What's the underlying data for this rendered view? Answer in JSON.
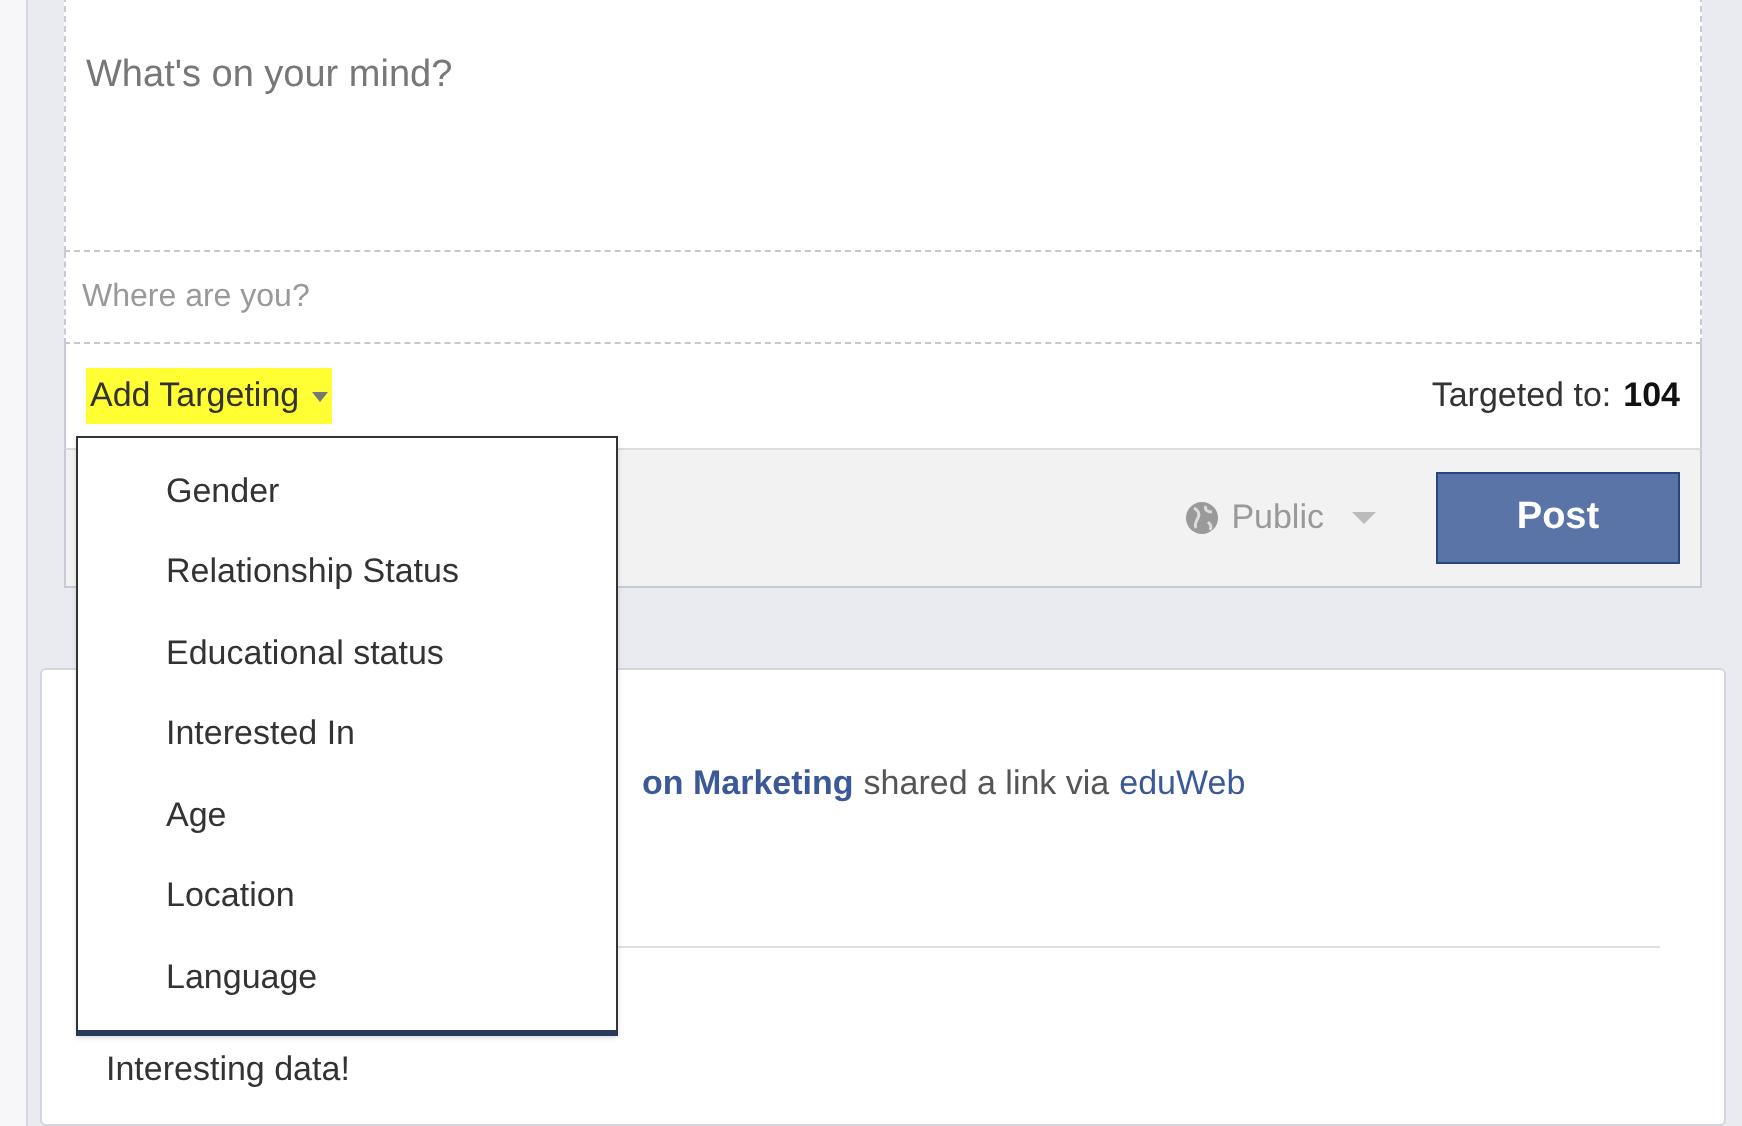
{
  "composer": {
    "placeholder": "What's on your mind?",
    "location_placeholder": "Where are you?",
    "targeting_label": "Add Targeting",
    "targeted_label": "Targeted to:",
    "targeted_count": "104",
    "privacy": "Public",
    "post_button": "Post"
  },
  "targeting_menu": {
    "items": [
      "Gender",
      "Relationship Status",
      "Educational status",
      "Interested In",
      "Age",
      "Location",
      "Language"
    ]
  },
  "story": {
    "author": "on Marketing",
    "action": "shared a link via",
    "app": "eduWeb",
    "message": "Interesting data!"
  }
}
